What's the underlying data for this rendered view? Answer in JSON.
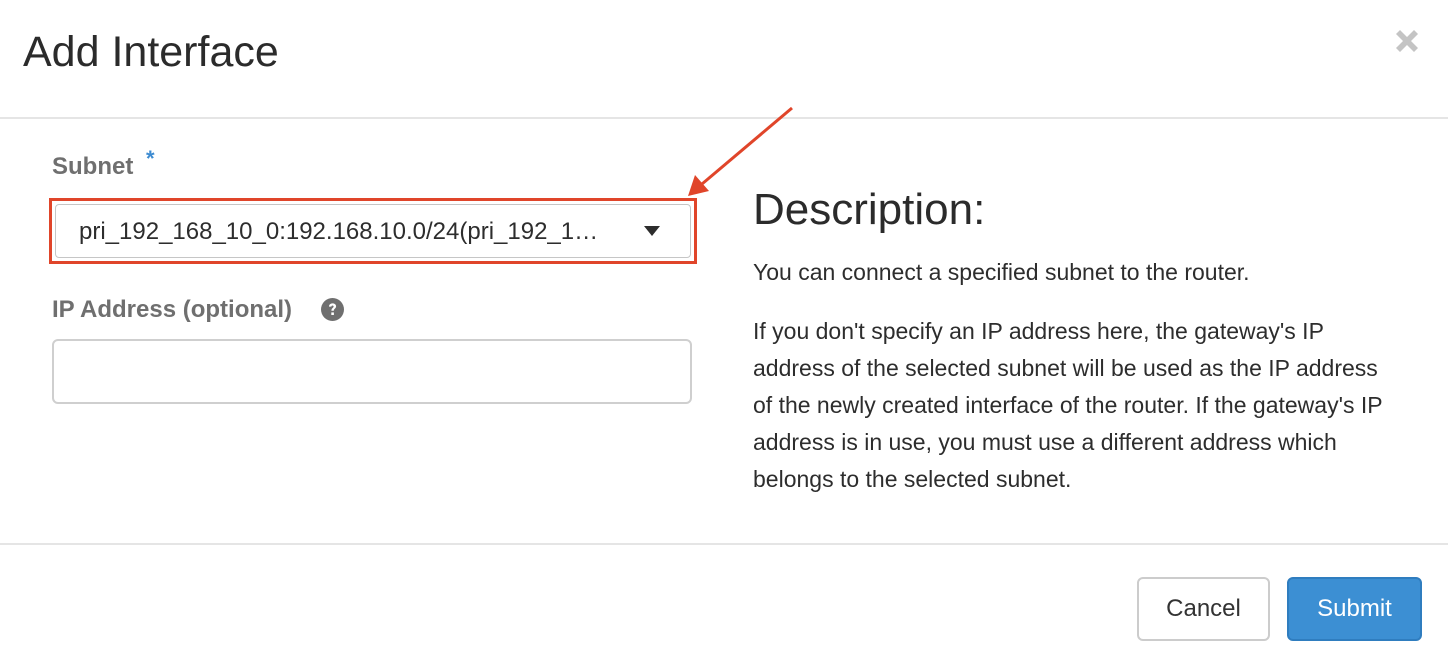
{
  "modal": {
    "title": "Add Interface",
    "close_icon": "close-icon"
  },
  "form": {
    "subnet": {
      "label": "Subnet",
      "required_marker": "*",
      "selected_value": "pri_192_168_10_0:192.168.10.0/24(pri_192_1…"
    },
    "ip_address": {
      "label": "IP Address (optional)",
      "help_icon": "question-circle-icon",
      "value": "",
      "placeholder": ""
    }
  },
  "description": {
    "title": "Description:",
    "paragraphs": [
      "You can connect a specified subnet to the router.",
      "If you don't specify an IP address here, the gateway's IP address of the selected subnet will be used as the IP address of the newly created interface of the router. If the gateway's IP address is in use, you must use a different address which belongs to the selected subnet."
    ]
  },
  "footer": {
    "cancel_label": "Cancel",
    "submit_label": "Submit"
  },
  "colors": {
    "primary": "#3c8fd3",
    "required": "#3d8bd1",
    "annotation": "#e0452a"
  }
}
